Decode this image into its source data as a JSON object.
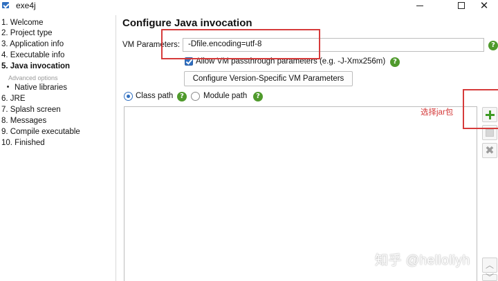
{
  "window": {
    "title": "exe4j",
    "icon": "exe4j-app-icon",
    "controls": [
      "minimize-icon",
      "maximize-icon",
      "close-icon"
    ]
  },
  "sidebar": {
    "steps": [
      {
        "label": "1. Welcome"
      },
      {
        "label": "2. Project type"
      },
      {
        "label": "3. Application info"
      },
      {
        "label": "4. Executable info"
      },
      {
        "label": "5. Java invocation",
        "active": true
      },
      {
        "label": "Advanced options",
        "sub_header": true
      },
      {
        "label": "Native libraries",
        "sub_item": true
      },
      {
        "label": "6. JRE"
      },
      {
        "label": "7. Splash screen"
      },
      {
        "label": "8. Messages"
      },
      {
        "label": "9. Compile executable"
      },
      {
        "label": "10. Finished"
      }
    ]
  },
  "main": {
    "title": "Configure Java invocation",
    "vm_parameters": {
      "label": "VM Parameters:",
      "value": "-Dfile.encoding=utf-8"
    },
    "passthrough": {
      "checked": true,
      "label": "Allow VM passthrough parameters (e.g. -J-Xmx256m)"
    },
    "config_button_label": "Configure Version-Specific VM Parameters",
    "path_mode": {
      "options": [
        {
          "label": "Class path",
          "selected": true
        },
        {
          "label": "Module path",
          "selected": false
        }
      ]
    },
    "list_buttons": [
      "add-icon",
      "edit-icon",
      "delete-icon",
      "move-up-icon",
      "move-down-icon"
    ]
  },
  "annotation": {
    "note": "选择jar包",
    "color": "#d63a3a"
  },
  "watermark": "知乎 @helloliyh",
  "colors": {
    "help_green": "#4f9a2c",
    "accent_blue": "#2f6fc0",
    "add_green": "#3d9a24"
  }
}
